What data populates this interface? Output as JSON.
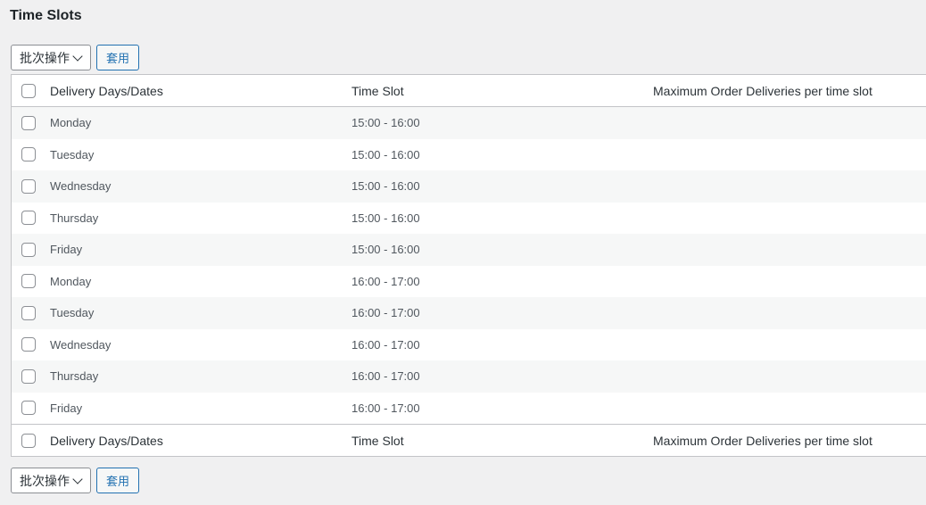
{
  "page": {
    "title": "Time Slots"
  },
  "bulk_actions": {
    "label": "批次操作",
    "apply": "套用"
  },
  "table": {
    "columns": [
      "Delivery Days/Dates",
      "Time Slot",
      "Maximum Order Deliveries per time slot"
    ],
    "rows": [
      {
        "day": "Monday",
        "slot": "15:00 - 16:00",
        "max": ""
      },
      {
        "day": "Tuesday",
        "slot": "15:00 - 16:00",
        "max": ""
      },
      {
        "day": "Wednesday",
        "slot": "15:00 - 16:00",
        "max": ""
      },
      {
        "day": "Thursday",
        "slot": "15:00 - 16:00",
        "max": ""
      },
      {
        "day": "Friday",
        "slot": "15:00 - 16:00",
        "max": ""
      },
      {
        "day": "Monday",
        "slot": "16:00 - 17:00",
        "max": ""
      },
      {
        "day": "Tuesday",
        "slot": "16:00 - 17:00",
        "max": ""
      },
      {
        "day": "Wednesday",
        "slot": "16:00 - 17:00",
        "max": ""
      },
      {
        "day": "Thursday",
        "slot": "16:00 - 17:00",
        "max": ""
      },
      {
        "day": "Friday",
        "slot": "16:00 - 17:00",
        "max": ""
      }
    ]
  },
  "colors": {
    "accent": "#2271b1",
    "border": "#c3c4c7",
    "background": "#f0f0f1",
    "row_alt": "#f6f7f7"
  },
  "icons": {
    "dropdown": "chevron-down-icon",
    "checkbox": "checkbox-icon"
  }
}
